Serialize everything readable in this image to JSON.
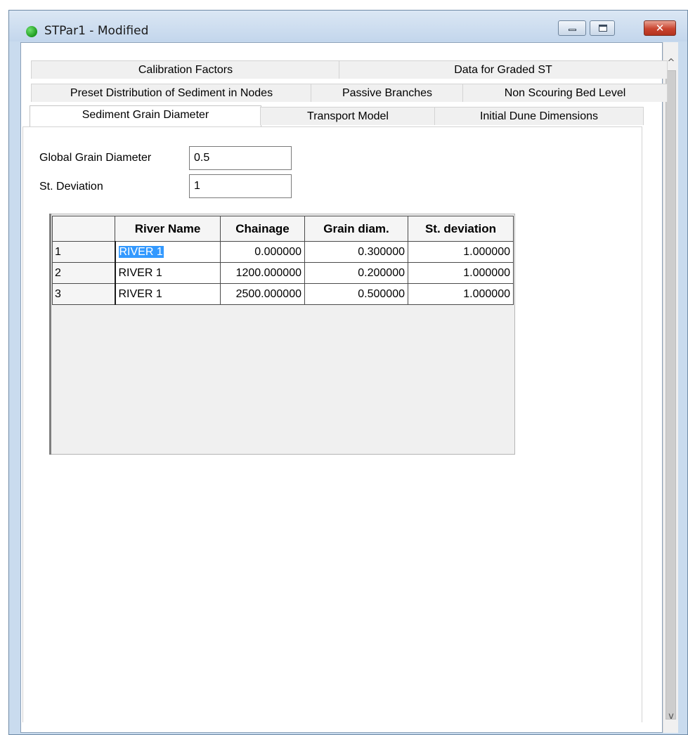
{
  "window": {
    "title": "STPar1 - Modified"
  },
  "tabs": {
    "row1": [
      "Calibration Factors",
      "Data for Graded ST"
    ],
    "row2": [
      "Preset Distribution of Sediment in Nodes",
      "Passive Branches",
      "Non Scouring Bed Level"
    ],
    "row3": [
      "Sediment Grain Diameter",
      "Transport Model",
      "Initial Dune Dimensions"
    ],
    "active": "Sediment Grain Diameter"
  },
  "form": {
    "global_grain_label": "Global Grain Diameter",
    "global_grain_value": "0.5",
    "st_deviation_label": "St. Deviation",
    "st_deviation_value": "1"
  },
  "table": {
    "columns": [
      "",
      "River Name",
      "Chainage",
      "Grain diam.",
      "St. deviation"
    ],
    "rows": [
      [
        "1",
        "RIVER 1",
        "0.000000",
        "0.300000",
        "1.000000"
      ],
      [
        "2",
        "RIVER 1",
        "1200.000000",
        "0.200000",
        "1.000000"
      ],
      [
        "3",
        "RIVER 1",
        "2500.000000",
        "0.500000",
        "1.000000"
      ]
    ]
  },
  "scrollbar": {
    "up_arrow": "^",
    "down_arrow": "v"
  }
}
